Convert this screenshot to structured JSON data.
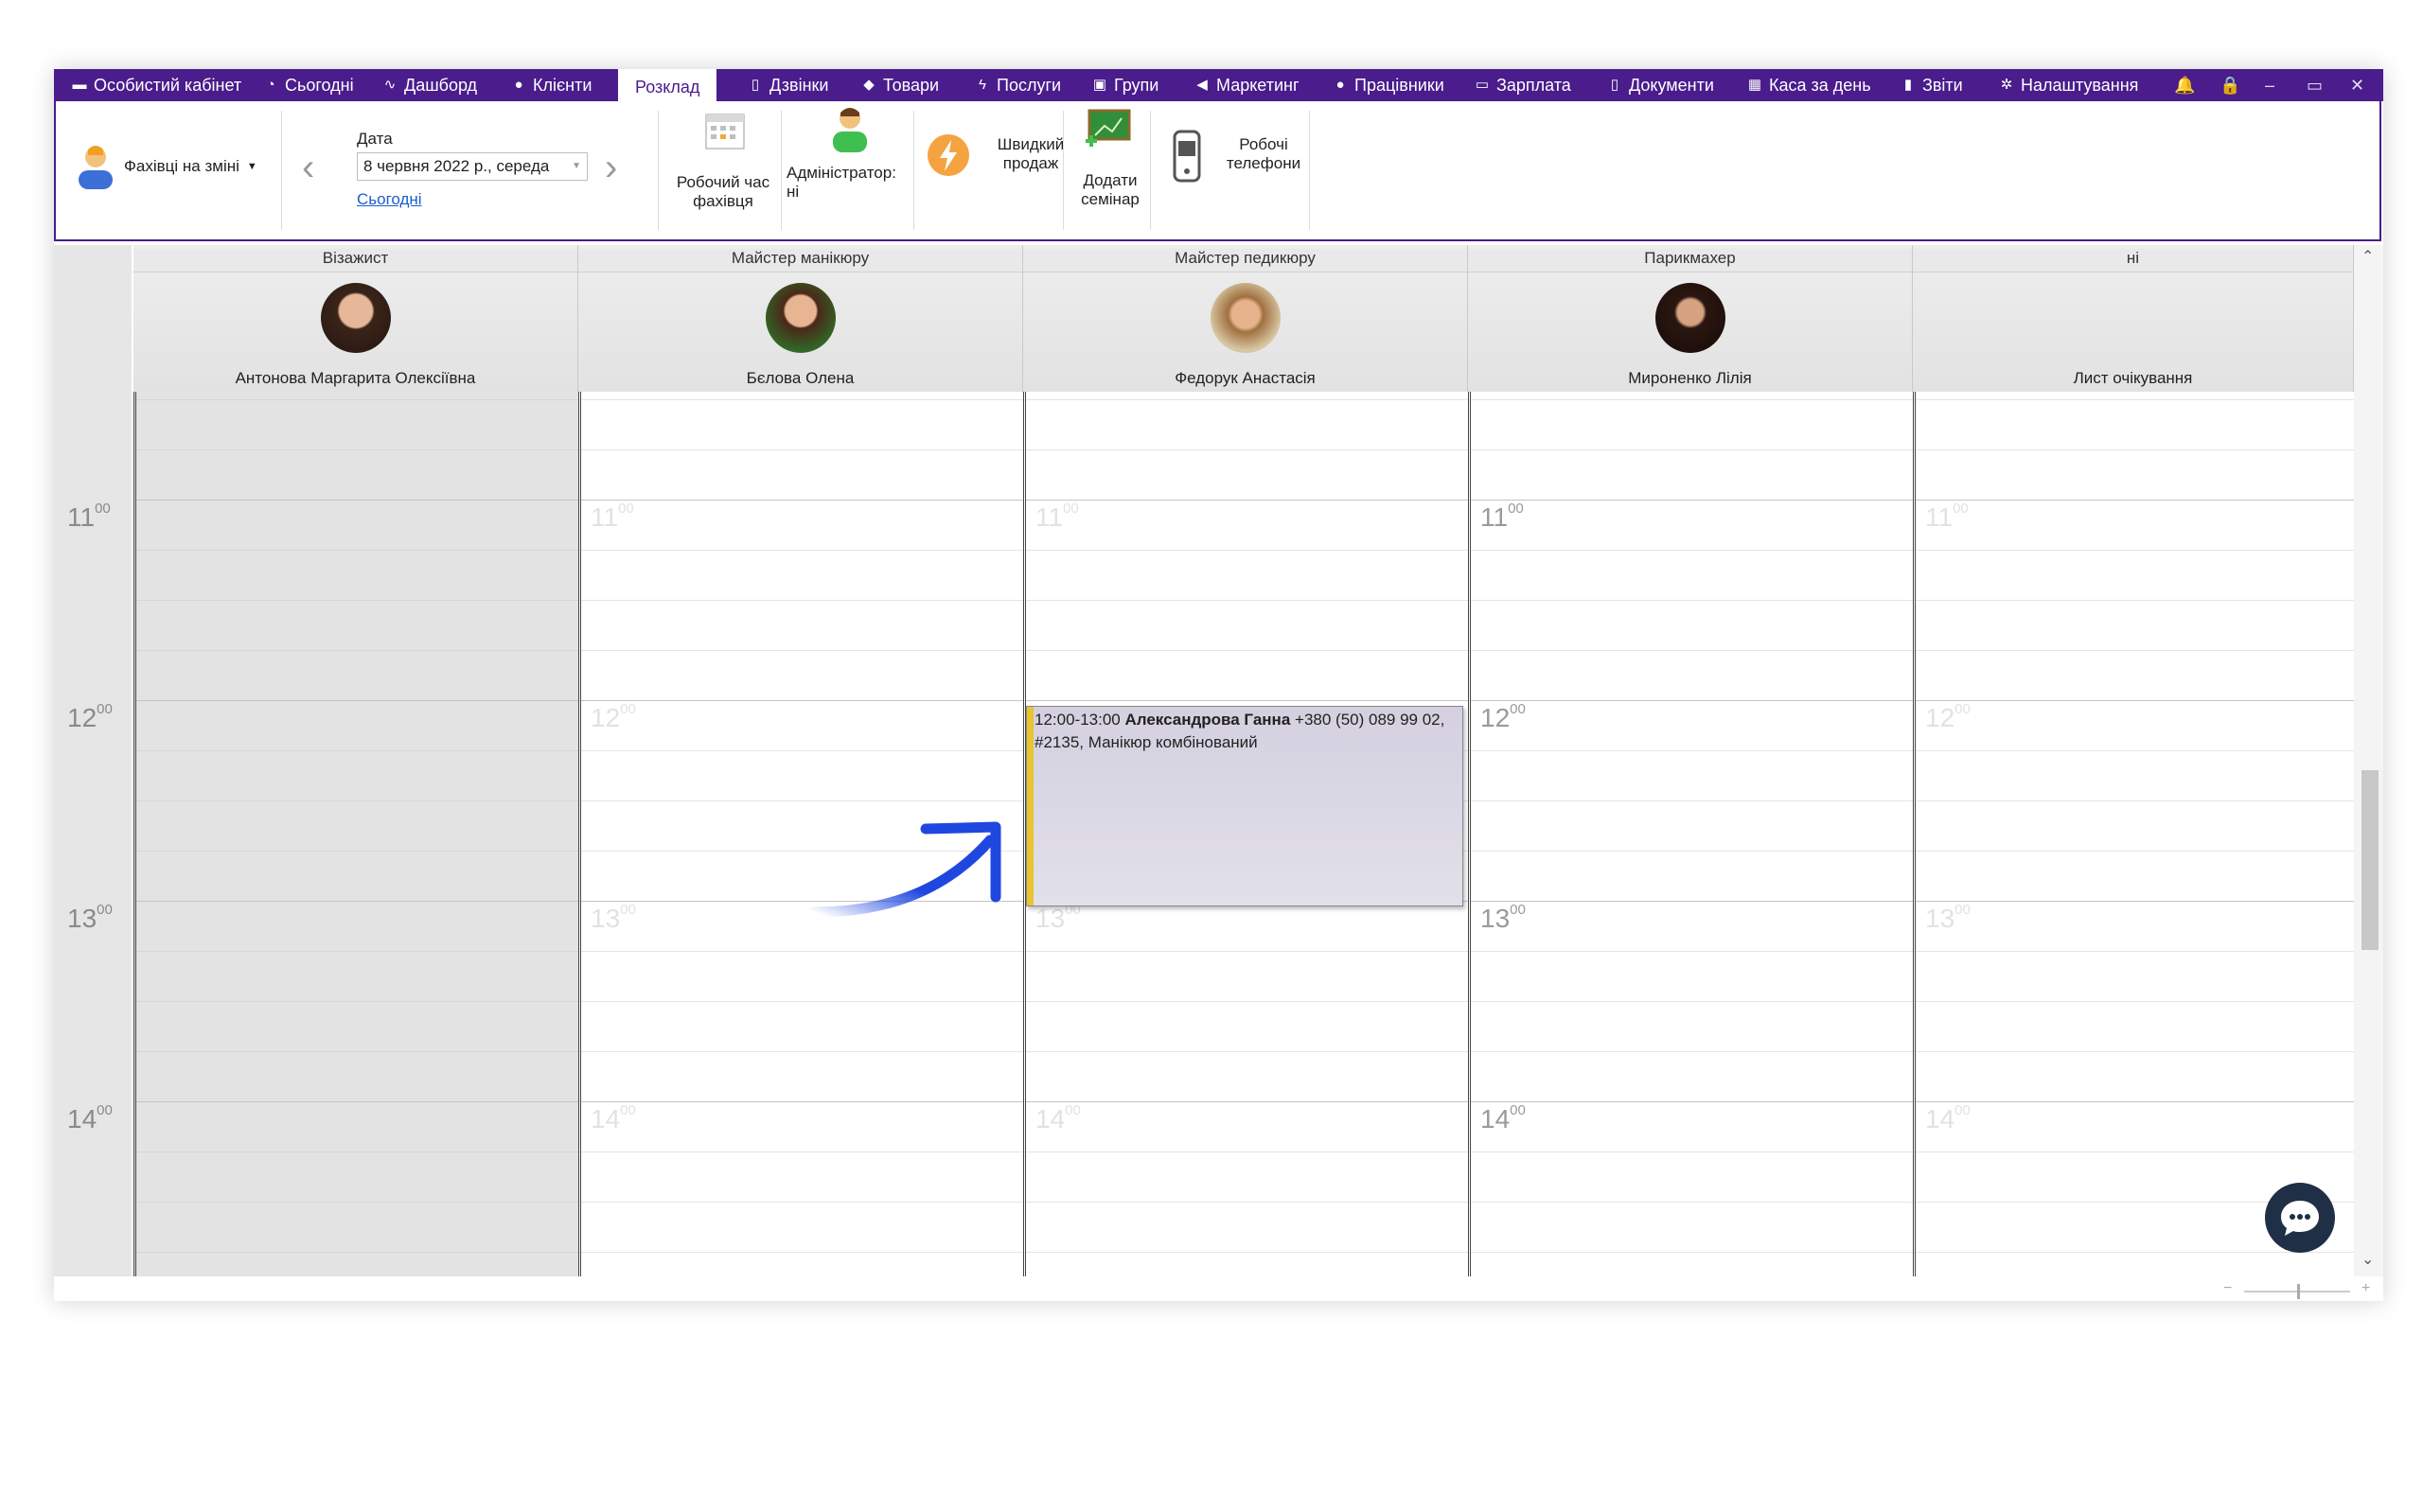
{
  "menu": {
    "items": [
      {
        "label": "Особистий кабінет",
        "icon": "wallet-icon",
        "glyph": "▬"
      },
      {
        "label": "Сьогодні",
        "icon": "clock-icon",
        "glyph": "◔"
      },
      {
        "label": "Дашборд",
        "icon": "pulse-icon",
        "glyph": "∿"
      },
      {
        "label": "Клієнти",
        "icon": "user-circle-icon",
        "glyph": "●"
      },
      {
        "label": "Розклад",
        "icon": "",
        "glyph": ""
      },
      {
        "label": "Дзвінки",
        "icon": "phone-icon",
        "glyph": "▯"
      },
      {
        "label": "Товари",
        "icon": "box-icon",
        "glyph": "◆"
      },
      {
        "label": "Послуги",
        "icon": "lightning-icon",
        "glyph": "ϟ"
      },
      {
        "label": "Групи",
        "icon": "groups-icon",
        "glyph": "▣"
      },
      {
        "label": "Маркетинг",
        "icon": "megaphone-icon",
        "glyph": "◀"
      },
      {
        "label": "Працівники",
        "icon": "person-icon",
        "glyph": "●"
      },
      {
        "label": "Зарплата",
        "icon": "money-icon",
        "glyph": "▭"
      },
      {
        "label": "Документи",
        "icon": "document-icon",
        "glyph": "▯"
      },
      {
        "label": "Каса за день",
        "icon": "calculator-icon",
        "glyph": "▦"
      },
      {
        "label": "Звіти",
        "icon": "bar-chart-icon",
        "glyph": "▮"
      },
      {
        "label": "Налаштування",
        "icon": "gear-icon",
        "glyph": "✲"
      }
    ],
    "active": "Розклад",
    "window_controls": [
      "🔔",
      "🔒",
      "–",
      "▭",
      "✕"
    ]
  },
  "ribbon": {
    "specialists_on_shift": "Фахівці на зміні",
    "date_label": "Дата",
    "date_value": "8 червня 2022 р., середа",
    "today_link": "Сьогодні",
    "work_time_line1": "Робочий час",
    "work_time_line2": "фахівця",
    "admin_line1": "Адміністратор:",
    "admin_line2": "ні",
    "quick_sale_line1": "Швидкий",
    "quick_sale_line2": "продаж",
    "seminar_line1": "Додати",
    "seminar_line2": "семінар",
    "phones_line1": "Робочі",
    "phones_line2": "телефони"
  },
  "columns": [
    {
      "role": "Візажист",
      "name": "Антонова Маргарита Олексіївна",
      "off": true
    },
    {
      "role": "Майстер манікюру",
      "name": "Бєлова Олена",
      "off": false
    },
    {
      "role": "Майстер педикюру",
      "name": "Федорук Анастасія",
      "off": false
    },
    {
      "role": "Парикмахер",
      "name": "Мироненко Лілія",
      "off": false
    },
    {
      "role": "ні",
      "name": "Лист очікування",
      "off": false
    }
  ],
  "hours": [
    "11",
    "12",
    "13",
    "14"
  ],
  "minutes": "00",
  "appointment": {
    "time": "12:00-13:00",
    "client": "Александрова Ганна",
    "phone": "+380 (50) 089 99 02,",
    "details": "#2135, Манікюр комбінований"
  },
  "colors": {
    "brand": "#4a1c8c",
    "appointment_bar": "#e8c430",
    "arrow": "#1f47e0"
  }
}
